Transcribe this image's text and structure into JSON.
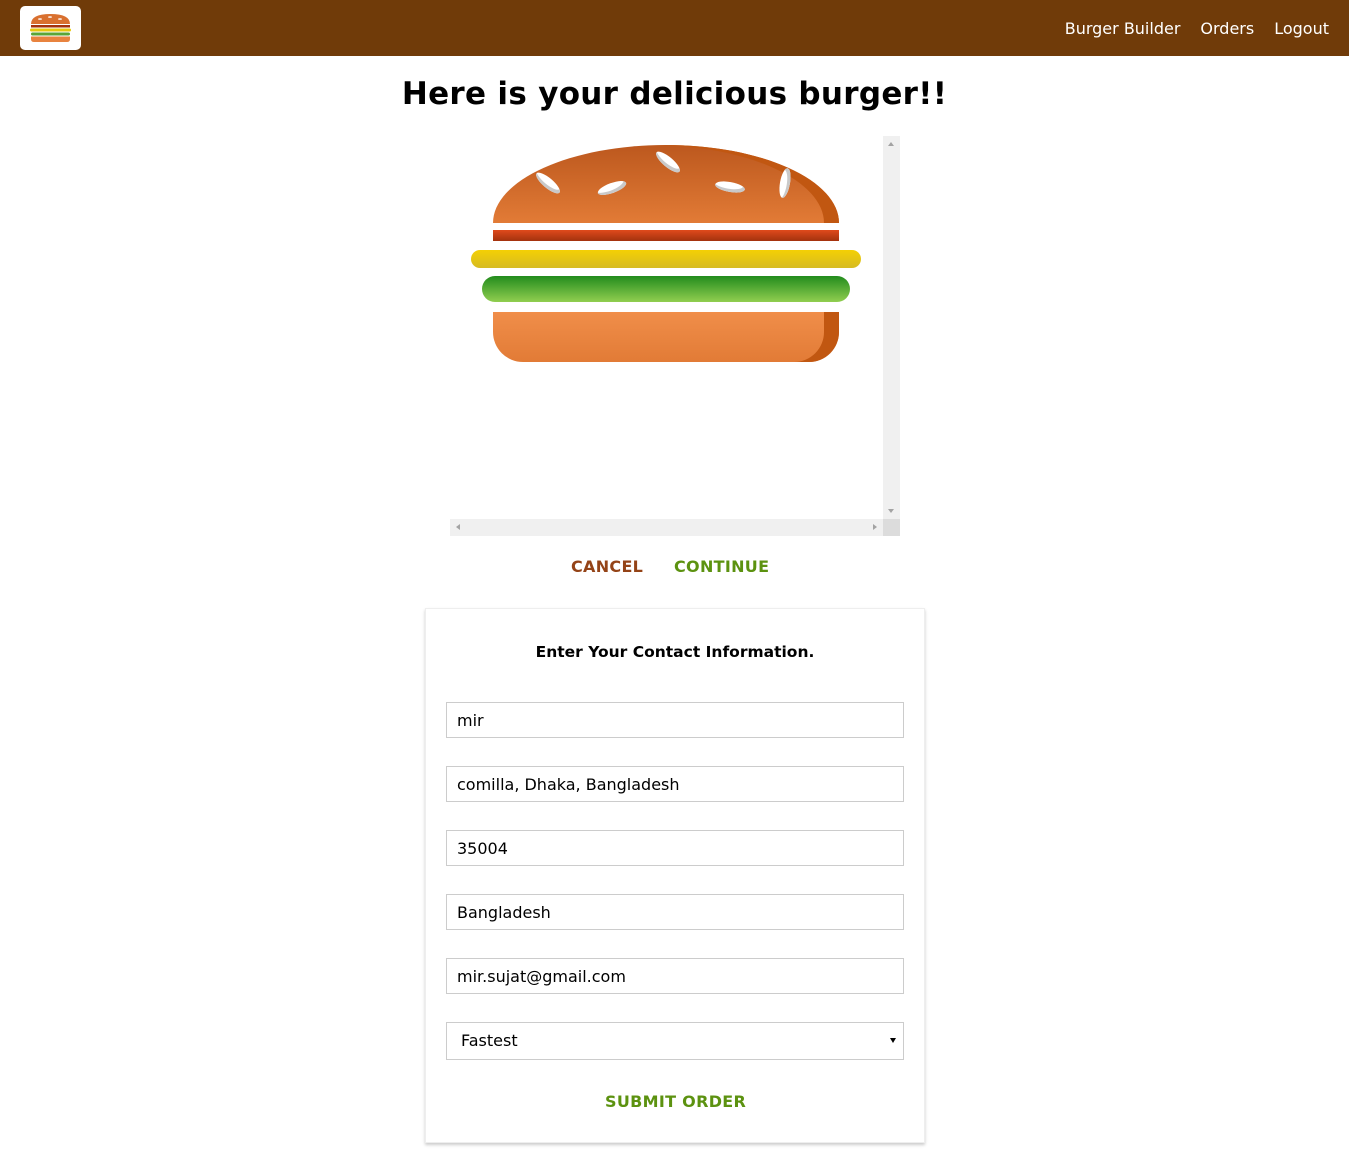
{
  "toolbar": {
    "logo_icon": "burger-logo-icon",
    "nav": [
      {
        "label": "Burger Builder"
      },
      {
        "label": "Orders"
      },
      {
        "label": "Logout"
      }
    ],
    "background": "#703B09"
  },
  "summary": {
    "title": "Here is your delicious burger!!",
    "ingredients": [
      "bread-top",
      "meat",
      "cheese",
      "salad",
      "bread-bottom"
    ],
    "cancel_label": "CANCEL",
    "continue_label": "CONTINUE"
  },
  "contact": {
    "title": "Enter Your Contact Information.",
    "fields": {
      "name": "mir",
      "street": "comilla, Dhaka, Bangladesh",
      "zip": "35004",
      "country": "Bangladesh",
      "email": "mir.sujat@gmail.com"
    },
    "delivery": {
      "selected": "Fastest"
    },
    "submit_label": "SUBMIT ORDER"
  },
  "colors": {
    "danger": "#944317",
    "success": "#5C9210"
  }
}
